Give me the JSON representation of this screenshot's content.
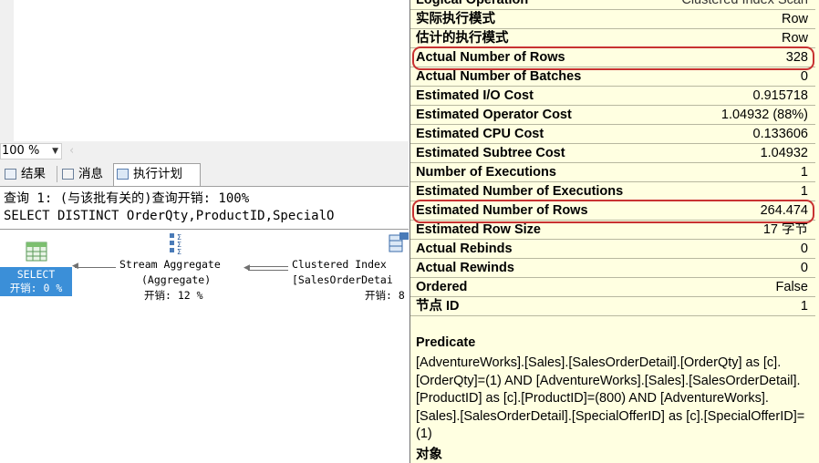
{
  "zoom": {
    "value": "100 %"
  },
  "tabs": [
    {
      "label": "结果",
      "icon": "grid-icon"
    },
    {
      "label": "消息",
      "icon": "message-icon"
    },
    {
      "label": "执行计划",
      "icon": "plan-icon"
    }
  ],
  "query": {
    "header": "查询 1: (与该批有关的)查询开销: 100%",
    "sql": "SELECT DISTINCT OrderQty,ProductID,SpecialO"
  },
  "plan": {
    "select": {
      "line1": "SELECT",
      "line2": "开销: 0 %"
    },
    "aggregate": {
      "line1": "Stream Aggregate",
      "line2": "(Aggregate)",
      "line3": "开销: 12 %"
    },
    "scan": {
      "line1": "Clustered Index",
      "line2": "[SalesOrderDetai",
      "line3": "开销: 8"
    }
  },
  "properties": {
    "partial_top": {
      "name": "Logical Operation",
      "value": "Clustered Index Scan"
    },
    "rows": [
      {
        "name": "实际执行模式",
        "value": "Row"
      },
      {
        "name": "估计的执行模式",
        "value": "Row"
      },
      {
        "name": "Actual Number of Rows",
        "value": "328"
      },
      {
        "name": "Actual Number of Batches",
        "value": "0"
      },
      {
        "name": "Estimated I/O Cost",
        "value": "0.915718"
      },
      {
        "name": "Estimated Operator Cost",
        "value": "1.04932 (88%)"
      },
      {
        "name": "Estimated CPU Cost",
        "value": "0.133606"
      },
      {
        "name": "Estimated Subtree Cost",
        "value": "1.04932"
      },
      {
        "name": "Number of Executions",
        "value": "1"
      },
      {
        "name": "Estimated Number of Executions",
        "value": "1"
      },
      {
        "name": "Estimated Number of Rows",
        "value": "264.474"
      },
      {
        "name": "Estimated Row Size",
        "value": "17 字节"
      },
      {
        "name": "Actual Rebinds",
        "value": "0"
      },
      {
        "name": "Actual Rewinds",
        "value": "0"
      },
      {
        "name": "Ordered",
        "value": "False"
      },
      {
        "name": "节点 ID",
        "value": "1"
      }
    ],
    "predicate_title": "Predicate",
    "predicate_text": "[AdventureWorks].[Sales].[SalesOrderDetail].[OrderQty] as [c].[OrderQty]=(1) AND [AdventureWorks].[Sales].[SalesOrderDetail].[ProductID] as [c].[ProductID]=(800) AND [AdventureWorks].[Sales].[SalesOrderDetail].[SpecialOfferID] as [c].[SpecialOfferID]=(1)",
    "object_title": "对象"
  },
  "colors": {
    "tooltip_bg": "#ffffe1",
    "highlight": "#c83232",
    "select_node": "#3b8fd8"
  }
}
